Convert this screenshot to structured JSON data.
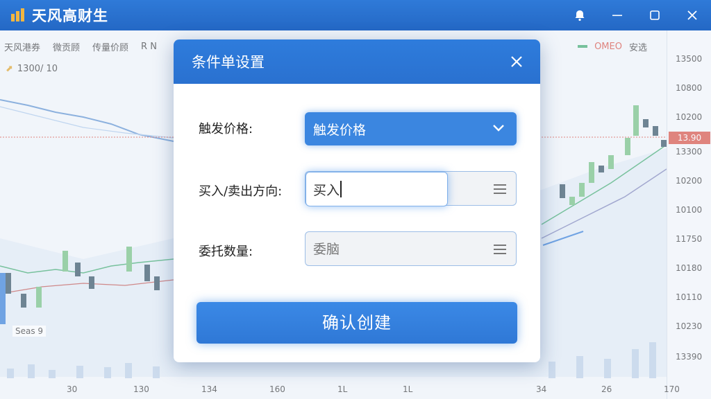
{
  "app": {
    "title": "天风高财生",
    "brand_color": "#2a6fc9",
    "logo_color": "#f3b640"
  },
  "window_controls": [
    "bell-icon",
    "minimize-icon",
    "maximize-icon",
    "close-icon"
  ],
  "toolbar": {
    "items": [
      "天风港券",
      "微贡顾",
      "传量价顾",
      "R N"
    ],
    "right_items": [
      "OMEO",
      "安选"
    ]
  },
  "info_row": {
    "text": "1300/ 10"
  },
  "legend": {
    "text": "Seas 9"
  },
  "price_axis": {
    "labels": [
      "13500",
      "10800",
      "10200",
      "13300",
      "10200",
      "10100",
      "11750",
      "10180",
      "10110",
      "10230",
      "13390"
    ],
    "current_price": "13.90",
    "current_price_color": "#d94a3d"
  },
  "time_axis": {
    "labels": [
      "30",
      "130",
      "134",
      "160",
      "1L",
      "1L",
      "34",
      "26",
      "170"
    ]
  },
  "modal": {
    "title": "条件单设置",
    "trigger_price": {
      "label": "触发价格:",
      "value": "触发价格"
    },
    "direction": {
      "label": "买入/卖出方向:",
      "value": "买入"
    },
    "quantity": {
      "label": "委托数量:",
      "placeholder": "委脑"
    },
    "confirm_label": "确认创建",
    "accent_color": "#2f7ad8"
  }
}
